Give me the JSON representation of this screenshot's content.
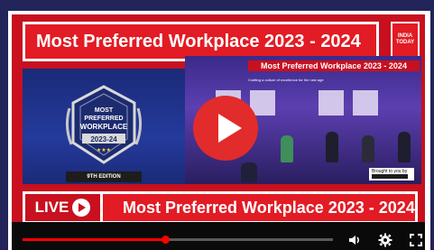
{
  "video": {
    "banner_title": "Most Preferred Workplace 2023 - 2024",
    "logo_lines": [
      "INDIA",
      "TODAY"
    ],
    "badge": {
      "line1": "MOST",
      "line2": "PREFERRED",
      "line3": "WORKPLACE",
      "year": "2023-24",
      "edition": "9TH EDITION"
    },
    "stage_title": "Most Preferred Workplace 2023 - 2024",
    "stage_subtitle": "Crafting a culture of excellence for the new age",
    "brought_by": "Brought to you by",
    "live_label": "LIVE",
    "lower_title": "Most Preferred Workplace 2023 - 2024"
  },
  "player": {
    "progress": 0.46,
    "colors": {
      "accent": "#ff0000",
      "banner": "#e21b24",
      "play": "#e22b2b"
    },
    "icons": [
      "play-icon",
      "volume-icon",
      "settings-gear-icon",
      "fullscreen-icon"
    ]
  }
}
